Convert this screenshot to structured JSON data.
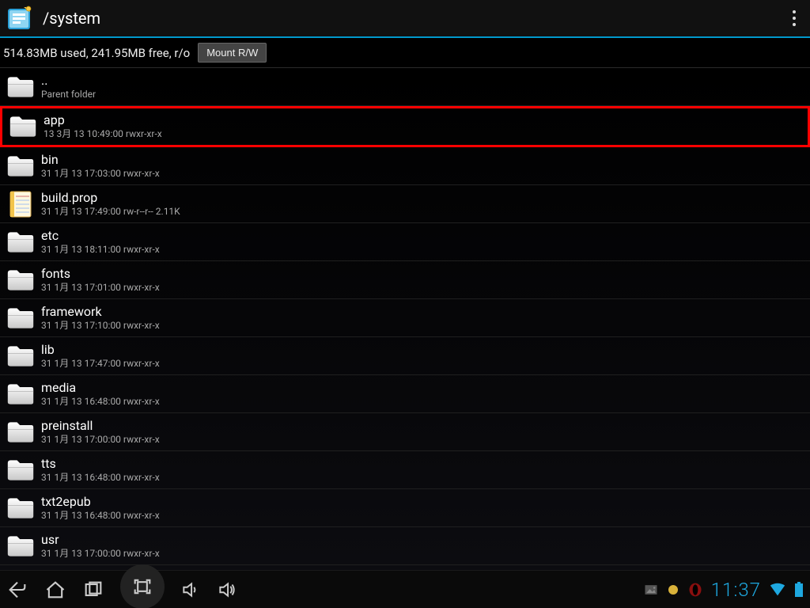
{
  "header": {
    "path": "/system",
    "status": "514.83MB used, 241.95MB free, r/o",
    "mount_btn": "Mount R/W"
  },
  "files": [
    {
      "name": "..",
      "meta": "Parent folder",
      "type": "folder",
      "highlight": false
    },
    {
      "name": "app",
      "meta": "13 3月 13 10:49:00  rwxr-xr-x",
      "type": "folder",
      "highlight": true
    },
    {
      "name": "bin",
      "meta": "31 1月 13 17:03:00  rwxr-xr-x",
      "type": "folder",
      "highlight": false
    },
    {
      "name": "build.prop",
      "meta": "31 1月 13 17:49:00  rw-r--r--  2.11K",
      "type": "file",
      "highlight": false
    },
    {
      "name": "etc",
      "meta": "31 1月 13 18:11:00  rwxr-xr-x",
      "type": "folder",
      "highlight": false
    },
    {
      "name": "fonts",
      "meta": "31 1月 13 17:01:00  rwxr-xr-x",
      "type": "folder",
      "highlight": false
    },
    {
      "name": "framework",
      "meta": "31 1月 13 17:10:00  rwxr-xr-x",
      "type": "folder",
      "highlight": false
    },
    {
      "name": "lib",
      "meta": "31 1月 13 17:47:00  rwxr-xr-x",
      "type": "folder",
      "highlight": false
    },
    {
      "name": "media",
      "meta": "31 1月 13 16:48:00  rwxr-xr-x",
      "type": "folder",
      "highlight": false
    },
    {
      "name": "preinstall",
      "meta": "31 1月 13 17:00:00  rwxr-xr-x",
      "type": "folder",
      "highlight": false
    },
    {
      "name": "tts",
      "meta": "31 1月 13 16:48:00  rwxr-xr-x",
      "type": "folder",
      "highlight": false
    },
    {
      "name": "txt2epub",
      "meta": "31 1月 13 16:48:00  rwxr-xr-x",
      "type": "folder",
      "highlight": false
    },
    {
      "name": "usr",
      "meta": "31 1月 13 17:00:00  rwxr-xr-x",
      "type": "folder",
      "highlight": false
    }
  ],
  "navbar": {
    "clock": "11:37"
  }
}
